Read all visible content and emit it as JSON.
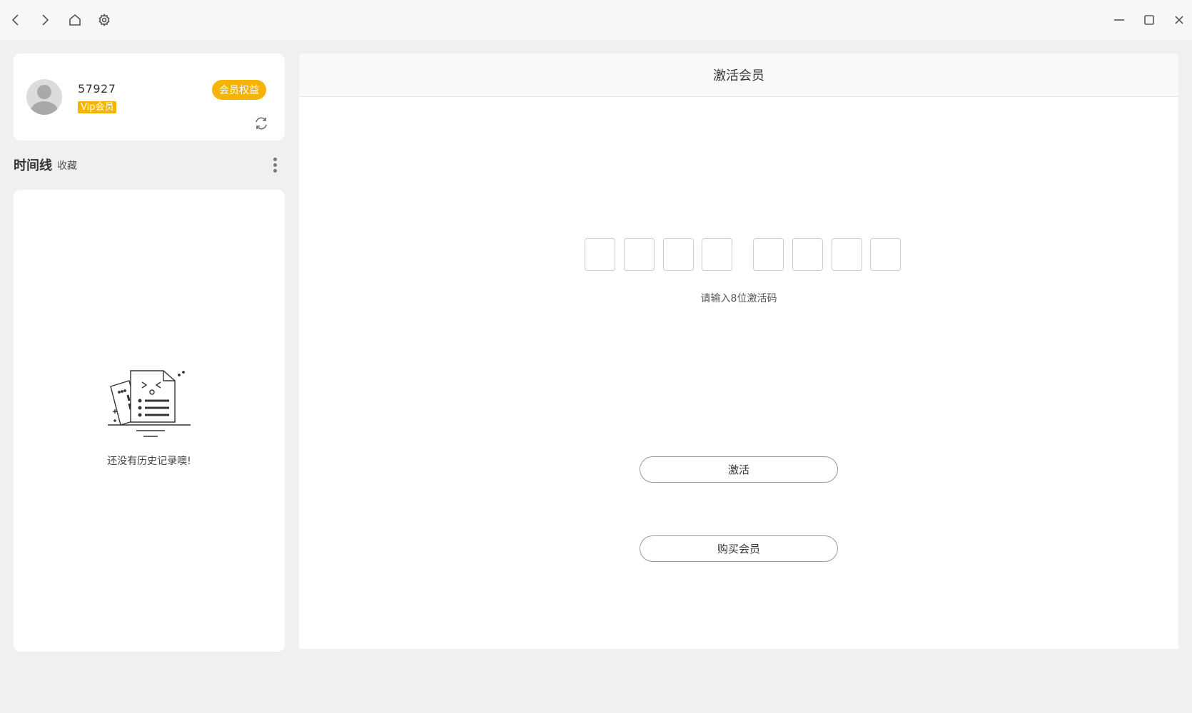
{
  "titlebar": {
    "nav_icons": [
      "chevron-left-icon",
      "chevron-right-icon",
      "home-icon",
      "gear-icon"
    ],
    "window_icons": [
      "minimize-icon",
      "maximize-icon",
      "close-icon"
    ]
  },
  "profile": {
    "username": "57927",
    "vip_label": "Vip会员",
    "benefits_label": "会员权益"
  },
  "sidebar": {
    "tabs": [
      {
        "label": "时间线"
      },
      {
        "label": "收藏"
      }
    ],
    "empty_text": "还没有历史记录噢!"
  },
  "main": {
    "title": "激活会员",
    "code_hint": "请输入8位激活码",
    "code_values": [
      "",
      "",
      "",
      "",
      "",
      "",
      "",
      ""
    ],
    "activate_label": "激活",
    "buy_label": "购买会员"
  },
  "colors": {
    "accent": "#f6b400",
    "background": "#f0f0f0"
  }
}
